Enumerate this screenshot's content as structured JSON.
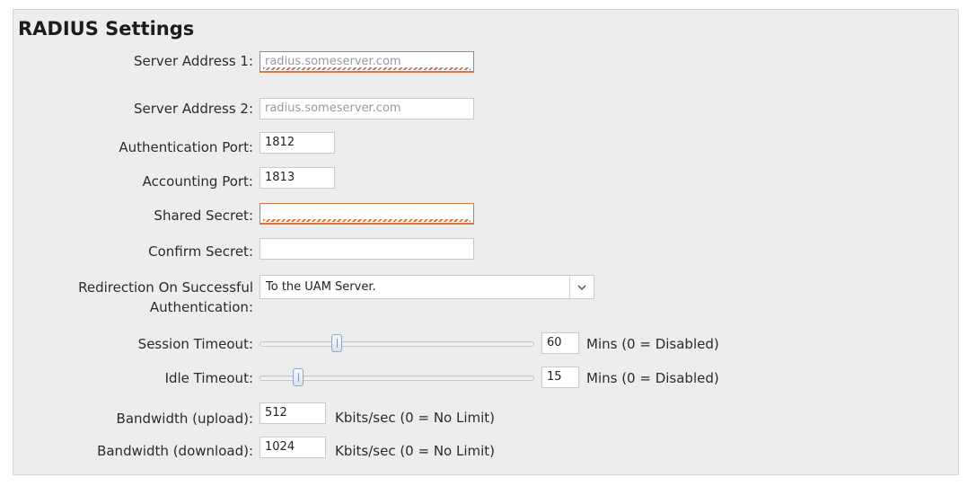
{
  "section": {
    "title": "RADIUS Settings"
  },
  "fields": {
    "server_address_1": {
      "label": "Server Address 1:",
      "placeholder": "radius.someserver.com"
    },
    "server_address_2": {
      "label": "Server Address 2:",
      "placeholder": "radius.someserver.com"
    },
    "authentication_port": {
      "label": "Authentication Port:",
      "value": "1812"
    },
    "accounting_port": {
      "label": "Accounting Port:",
      "value": "1813"
    },
    "shared_secret": {
      "label": "Shared Secret:",
      "value": ""
    },
    "confirm_secret": {
      "label": "Confirm Secret:",
      "value": ""
    },
    "redirection": {
      "label_line1": "Redirection On Successful",
      "label_line2": "Authentication:",
      "selected": "To the UAM Server."
    },
    "session_timeout": {
      "label": "Session Timeout:",
      "value": "60",
      "unit": "Mins (0 = Disabled)",
      "slider_fraction": 0.28
    },
    "idle_timeout": {
      "label": "Idle Timeout:",
      "value": "15",
      "unit": "Mins (0 = Disabled)",
      "slider_fraction": 0.14
    },
    "bandwidth_upload": {
      "label": "Bandwidth (upload):",
      "value": "512",
      "unit": "Kbits/sec (0 = No Limit)"
    },
    "bandwidth_download": {
      "label": "Bandwidth (download):",
      "value": "1024",
      "unit": "Kbits/sec (0 = No Limit)"
    }
  },
  "colors": {
    "error_border": "#d9763f",
    "panel_bg": "#ededed"
  },
  "icons": {
    "select_arrow": "chevron-down-icon"
  }
}
